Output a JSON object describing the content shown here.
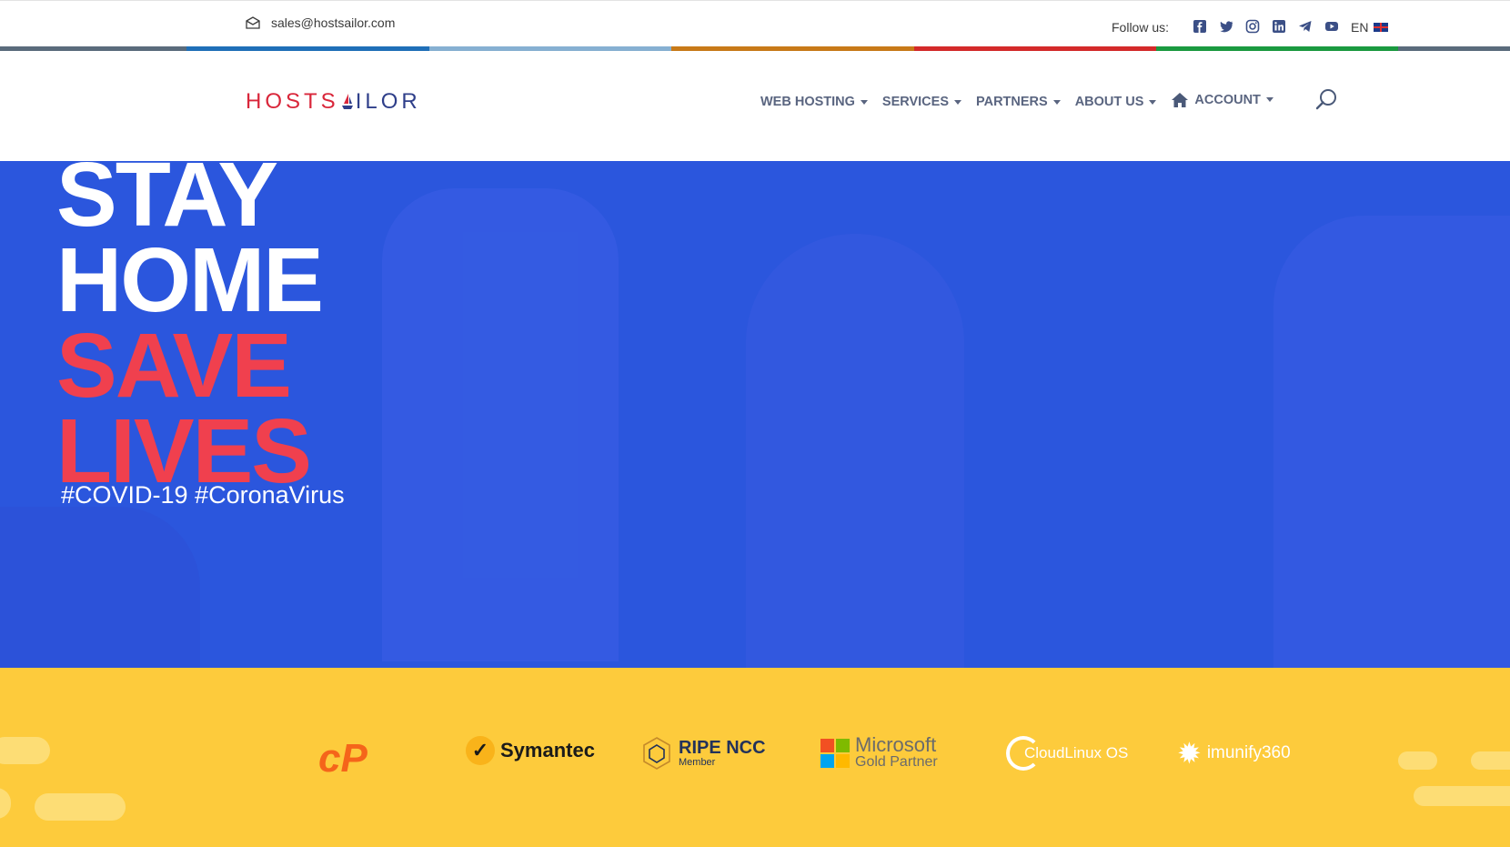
{
  "topbar": {
    "email": "sales@hostsailor.com",
    "follow_label": "Follow us:",
    "socials": [
      "facebook-icon",
      "twitter-icon",
      "instagram-icon",
      "linkedin-icon",
      "telegram-icon",
      "youtube-icon"
    ],
    "language": "EN"
  },
  "stripe_colors": [
    "#5a6b7c",
    "#1f6fb8",
    "#86b0d2",
    "#c87a18",
    "#d42a2a",
    "#1a9a40",
    "#5a6b7c"
  ],
  "header": {
    "logo_left": "HOSTS",
    "logo_right": "ILOR",
    "nav": [
      {
        "label": "WEB HOSTING"
      },
      {
        "label": "SERVICES"
      },
      {
        "label": "PARTNERS"
      },
      {
        "label": "ABOUT US"
      },
      {
        "label": "ACCOUNT"
      }
    ]
  },
  "hero": {
    "line1": "STAY",
    "line2": "HOME",
    "line3": "SAVE",
    "line4": "LIVES",
    "hashtags": "#COVID-19 #CoronaVirus",
    "background_color": "#2b56dd",
    "accent_color": "#f0404e"
  },
  "partners": {
    "background_color": "#fdcb3c",
    "logos": {
      "cpanel": "cP",
      "symantec": "Symantec",
      "ripe_title": "RIPE NCC",
      "ripe_sub": "Member",
      "microsoft_title": "Microsoft",
      "microsoft_sub": "Gold Partner",
      "cloudlinux": "CloudLinux OS",
      "imunify": "imunify360"
    }
  }
}
